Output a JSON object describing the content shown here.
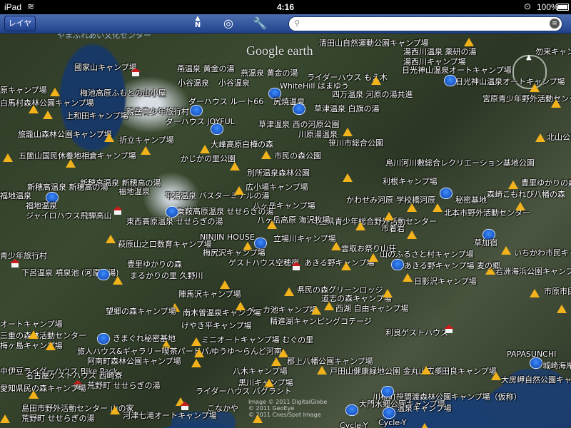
{
  "status": {
    "device": "iPad",
    "time": "4:16",
    "battery": "100%"
  },
  "toolbar": {
    "layer_button": "レイヤ",
    "north": "N",
    "search_placeholder": ""
  },
  "map": {
    "watermark": "Google earth",
    "credit_lines": [
      "Image © 2011 DigitalGlobe",
      "© 2011 GeoEye",
      "© 2011 Cnes/Spot Image"
    ],
    "ghost_text": "やまぶれあい文化センター"
  },
  "places": [
    {
      "label": "清田山自然運動公園キャンプ場"
    },
    {
      "label": "湯西川温泉 薬研の湯"
    },
    {
      "label": "湯西川キャンプ場"
    },
    {
      "label": "勿来キャンプ場"
    },
    {
      "label": "日光神山温泉オートキャンプ場"
    },
    {
      "label": "國家山キャンプ場"
    },
    {
      "label": "燕温泉 黄金の湯"
    },
    {
      "label": "ライダーハウス もえ木"
    },
    {
      "label": "日光神山温泉オートキャンプ場"
    },
    {
      "label": "原キャンプ場"
    },
    {
      "label": "梅池高原ふもとの山小屋"
    },
    {
      "label": "小谷温泉"
    },
    {
      "label": "WhiteHill はまゆう"
    },
    {
      "label": "四万温泉 河原の湯共進"
    },
    {
      "label": "宮原青少年野外活動センター"
    },
    {
      "label": "白馬村森林公園キャンプ場"
    },
    {
      "label": "ダーハウス ルート66"
    },
    {
      "label": "尻焼温泉"
    },
    {
      "label": "草津温泉 白旗の湯"
    },
    {
      "label": "上和田キャンプ場"
    },
    {
      "label": "親岳青少年旅行村"
    },
    {
      "label": "ダーハウス JOYFUL"
    },
    {
      "label": "草津温泉 西の河原公園"
    },
    {
      "label": "川原湯温泉"
    },
    {
      "label": "北山公園"
    },
    {
      "label": "旅籠山森林公園キャンプ場"
    },
    {
      "label": "折立キャンプ場"
    },
    {
      "label": "大峰高原白樺の森"
    },
    {
      "label": "笹川市総合公園"
    },
    {
      "label": "五箇山国民休養地相倉キャンプ場"
    },
    {
      "label": "かじかの里公園"
    },
    {
      "label": "市民の森公園"
    },
    {
      "label": "烏川河川敷総合レクリエーション基地公園"
    },
    {
      "label": "新穂高温泉 新穂高の湯"
    },
    {
      "label": "別所温泉森林公園"
    },
    {
      "label": "利根キャンプ場"
    },
    {
      "label": "豊里ゆかりの森"
    },
    {
      "label": "福地温泉"
    },
    {
      "label": "広小場キャンプ場"
    },
    {
      "label": "かわせみ河原"
    },
    {
      "label": "学校橋河原"
    },
    {
      "label": "秘密基地"
    },
    {
      "label": "森崎こもれび八幡の森"
    },
    {
      "label": "平湯温泉 バスターミナルの湯"
    },
    {
      "label": "北本市野外活動センター"
    },
    {
      "label": "ジャイロハウス飛騨高山"
    },
    {
      "label": "乗鞍高原温泉 せせらぎの湯"
    },
    {
      "label": "八ヶ岳キャンプ場"
    },
    {
      "label": "埼玉県青少年総合野外活動センター"
    },
    {
      "label": "東西高原温泉 せせらぎの湯"
    },
    {
      "label": "八ヶ岳高原 海沢牧場"
    },
    {
      "label": "市着岩"
    },
    {
      "label": "NINJIN HOUSE"
    },
    {
      "label": "立場川キャンプ場"
    },
    {
      "label": "草加宿"
    },
    {
      "label": "萩原山之口数育キャンプ場"
    },
    {
      "label": "梅尻沢キャンプ場"
    },
    {
      "label": "雲取お祭り山荘"
    },
    {
      "label": "いちかわ市民キャ"
    },
    {
      "label": "青少年旅行村"
    },
    {
      "label": "ゲストハウス空穂宿"
    },
    {
      "label": "あきる野キャンプ場"
    },
    {
      "label": "山のふるさと村キャンプ場"
    },
    {
      "label": "若洲海浜公園キャンプ場"
    },
    {
      "label": "下呂温泉 噴泉池 (河原の湯)"
    },
    {
      "label": "まるかりの里 久野川"
    },
    {
      "label": "あきる野キャンプ場 麦の郷"
    },
    {
      "label": "日影沢キャンプ場"
    },
    {
      "label": "市原市民"
    },
    {
      "label": "陣馬沢キャンプ場"
    },
    {
      "label": "県民の森グリーンロッジ"
    },
    {
      "label": "道志の森キャンプ場"
    },
    {
      "label": "南木曽温泉キャンプ場"
    },
    {
      "label": "望郷の森キャンプ場"
    },
    {
      "label": "ベーカ池キャンプ場"
    },
    {
      "label": "西湖 自由キャンプ場"
    },
    {
      "label": "オートキャンプ場"
    },
    {
      "label": "けやき平キャンプ場"
    },
    {
      "label": "精進湖キャンピングコテージ"
    },
    {
      "label": "三重の森林活動センター"
    },
    {
      "label": "きまぐれ秘密基地"
    },
    {
      "label": "利良ゲストハウス"
    },
    {
      "label": "ミニオートキャンプ場 むぐの里"
    },
    {
      "label": "旅人ハウス&ギャラリー喫茶パードパパ"
    },
    {
      "label": "ゆうゆ〜らんど河南"
    },
    {
      "label": "PAPASUNCHI"
    },
    {
      "label": "城崎海岸"
    },
    {
      "label": "郡上八幡公園キャンプ場"
    },
    {
      "label": "阿南町森林公園キャンプ場"
    },
    {
      "label": "梅ヶ島キャンプ場"
    },
    {
      "label": "八木キャンプ場"
    },
    {
      "label": "戸田山健康緑地公園 金丸山広場"
    },
    {
      "label": "多田良キャンプ場"
    },
    {
      "label": "名古屋ゲストハウス 西崎寮"
    },
    {
      "label": "大房岬自然公園キャンプ場"
    },
    {
      "label": "黒川キャンプ場"
    },
    {
      "label": "中伊豆ライダーハウス Bike Pack"
    },
    {
      "label": "川根町笹間渡森林公園キャンプ場（仮称）"
    },
    {
      "label": "ライダーハウス バグラント"
    },
    {
      "label": "温泉キャンプ場"
    },
    {
      "label": "愛知県民の森キャンプ場"
    },
    {
      "label": "荒野町 せせらぎの湯"
    },
    {
      "label": "島田市野外活動センター 山の家"
    },
    {
      "label": "こなかや"
    },
    {
      "label": "大門水郷公園キャンプ場"
    },
    {
      "label": "河津七滝オートキャンプ場"
    },
    {
      "label": "荒野町 せせらぎの湯"
    },
    {
      "label": "Cycle-Y"
    }
  ]
}
